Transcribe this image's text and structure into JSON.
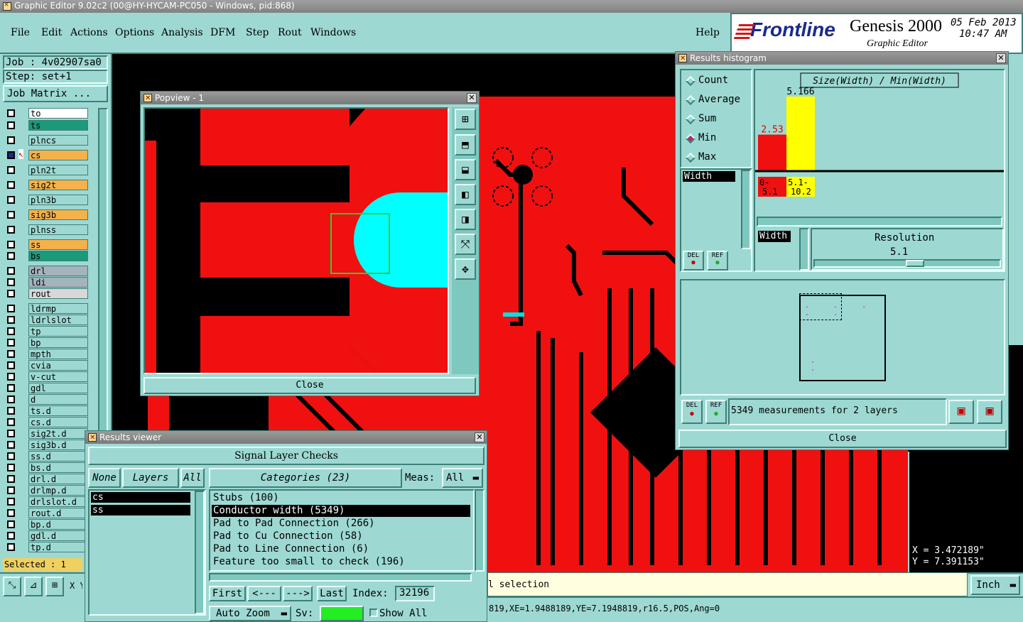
{
  "window": {
    "title": "Graphic Editor 9.02c2 (00@HY-HYCAM-PC050 - Windows, pid:868)"
  },
  "menu": {
    "items": [
      "File",
      "Edit",
      "Actions",
      "Options",
      "Analysis",
      "DFM",
      "Step",
      "Rout",
      "Windows"
    ],
    "help": "Help"
  },
  "brand": {
    "logo": "Frontline",
    "product": "Genesis 2000",
    "subtitle": "Graphic Editor",
    "date": "05 Feb 2013",
    "time": "10:47 AM"
  },
  "job": {
    "job_label": "Job : 4v02907sa0",
    "step_label": "Step: set+1",
    "matrix_button": "Job Matrix ..."
  },
  "layers": [
    {
      "name": "to",
      "color": "#ffffff"
    },
    {
      "name": "ts",
      "color": "#1a9a78"
    },
    {
      "name": "plncs",
      "color": "#9dd9d2"
    },
    {
      "name": "cs",
      "color": "#f5b14a"
    },
    {
      "name": "pln2t",
      "color": "#9dd9d2"
    },
    {
      "name": "sig2t",
      "color": "#f5b14a"
    },
    {
      "name": "pln3b",
      "color": "#9dd9d2"
    },
    {
      "name": "sig3b",
      "color": "#f5b14a"
    },
    {
      "name": "plnss",
      "color": "#9dd9d2"
    },
    {
      "name": "ss",
      "color": "#f5b14a"
    },
    {
      "name": "bs",
      "color": "#1a9a78"
    },
    {
      "name": "drl",
      "color": "#a5b3bd"
    },
    {
      "name": "ldi",
      "color": "#a5b3bd"
    },
    {
      "name": "rout",
      "color": "#d8d8d8"
    },
    {
      "name": "ldrmp",
      "color": "#9dd9d2"
    },
    {
      "name": "ldrlslot",
      "color": "#9dd9d2"
    },
    {
      "name": "tp",
      "color": "#9dd9d2"
    },
    {
      "name": "bp",
      "color": "#9dd9d2"
    },
    {
      "name": "mpth",
      "color": "#9dd9d2"
    },
    {
      "name": "cvia",
      "color": "#9dd9d2"
    },
    {
      "name": "v-cut",
      "color": "#9dd9d2"
    },
    {
      "name": "gdl",
      "color": "#9dd9d2"
    },
    {
      "name": "d",
      "color": "#9dd9d2"
    },
    {
      "name": "ts.d",
      "color": "#9dd9d2"
    },
    {
      "name": "cs.d",
      "color": "#9dd9d2"
    },
    {
      "name": "sig2t.d",
      "color": "#9dd9d2"
    },
    {
      "name": "sig3b.d",
      "color": "#9dd9d2"
    },
    {
      "name": "ss.d",
      "color": "#9dd9d2"
    },
    {
      "name": "bs.d",
      "color": "#9dd9d2"
    },
    {
      "name": "drl.d",
      "color": "#9dd9d2"
    },
    {
      "name": "drlmp.d",
      "color": "#9dd9d2"
    },
    {
      "name": "drlslot.d",
      "color": "#9dd9d2"
    },
    {
      "name": "rout.d",
      "color": "#9dd9d2"
    },
    {
      "name": "bp.d",
      "color": "#9dd9d2"
    },
    {
      "name": "gdl.d",
      "color": "#9dd9d2"
    },
    {
      "name": "tp.d",
      "color": "#9dd9d2"
    }
  ],
  "selected_label": "Selected : 1",
  "popview": {
    "title": "Popview - 1",
    "close": "Close"
  },
  "results_viewer": {
    "title": "Results viewer",
    "heading": "Signal Layer Checks",
    "none": "None",
    "layers": "Layers",
    "all": "All",
    "categories": "Categories (23)",
    "meas_label": "Meas:",
    "meas_value": "All",
    "layer_list": [
      "cs",
      "ss"
    ],
    "category_list": [
      "Stubs (100)",
      "Conductor width (5349)",
      "Pad to Pad Connection (266)",
      "Pad to Cu Connection (58)",
      "Pad to Line Connection (6)",
      "Feature too small to check (196)"
    ],
    "first": "First",
    "prev": "<---",
    "next": "--->",
    "last": "Last",
    "index_label": "Index:",
    "index_value": "32196",
    "auto_zoom": "Auto Zoom",
    "sv_label": "Sv:",
    "show_all": "Show All"
  },
  "histogram": {
    "title": "Results histogram",
    "options": [
      "Count",
      "Average",
      "Sum",
      "Min",
      "Max"
    ],
    "selected_option": "Min",
    "chart_title": "Size(Width) / Min(Width)",
    "bar1_value": "2.53",
    "bar2_value": "5.166",
    "bar1_label": "0-\n5.1",
    "bar2_label": "5.1-\n10.2",
    "bar1_top": "0-",
    "bar1_bot": "5.1",
    "bar2_top": "5.1-",
    "bar2_bot": "10.2",
    "attr_list": "Width",
    "attr_sel": "Width",
    "resolution_label": "Resolution",
    "resolution_value": "5.1",
    "del": "DEL",
    "ref": "REF",
    "measurements": "5349 measurements for 2 layers",
    "close": "Close"
  },
  "chart_data": {
    "type": "bar",
    "title": "Size(Width) / Min(Width)",
    "categories": [
      "0-5.1",
      "5.1-10.2"
    ],
    "values": [
      2.53,
      5.166
    ],
    "colors": [
      "#f01010",
      "#ffff00"
    ]
  },
  "status": {
    "selection": "l selection",
    "coords_line": "819,XE=1.9488189,YE=7.1948819,r16.5,POS,Ang=0",
    "units": "Inch",
    "x": "X = 3.472189\"",
    "y": "Y = 7.391153\"",
    "x_prefix": "X Y"
  }
}
